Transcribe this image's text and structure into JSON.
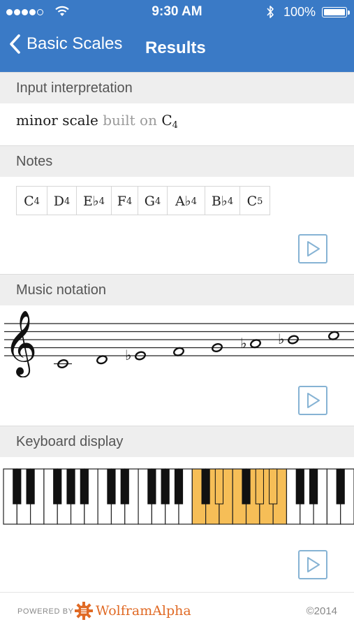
{
  "status_bar": {
    "time": "9:30 AM",
    "battery": "100%",
    "signal_bars_filled": 4,
    "signal_bars_total": 5
  },
  "nav": {
    "back_label": "Basic Scales",
    "title": "Results"
  },
  "pods": {
    "input": {
      "title": "Input interpretation",
      "text_main": "minor scale",
      "text_connector": "built on",
      "note_letter": "C",
      "note_octave": "4"
    },
    "notes": {
      "title": "Notes",
      "items": [
        {
          "name": "C",
          "octave": "4"
        },
        {
          "name": "D",
          "octave": "4"
        },
        {
          "name": "E♭",
          "octave": "4"
        },
        {
          "name": "F",
          "octave": "4"
        },
        {
          "name": "G",
          "octave": "4"
        },
        {
          "name": "A♭",
          "octave": "4"
        },
        {
          "name": "B♭",
          "octave": "4"
        },
        {
          "name": "C",
          "octave": "5"
        }
      ]
    },
    "notation": {
      "title": "Music notation",
      "clef": "treble-clef-icon",
      "notes": [
        {
          "pitch": "C4",
          "accidental": ""
        },
        {
          "pitch": "D4",
          "accidental": ""
        },
        {
          "pitch": "E4",
          "accidental": "flat"
        },
        {
          "pitch": "F4",
          "accidental": ""
        },
        {
          "pitch": "G4",
          "accidental": ""
        },
        {
          "pitch": "A4",
          "accidental": "flat"
        },
        {
          "pitch": "B4",
          "accidental": "flat"
        },
        {
          "pitch": "C5",
          "accidental": ""
        }
      ]
    },
    "keyboard": {
      "title": "Keyboard display",
      "white_key_count": 26,
      "highlighted_white_keys": [
        14,
        15,
        16,
        17,
        18,
        19,
        20
      ],
      "highlighted_black_keys": [
        15,
        18,
        19
      ],
      "highlight_color": "#f6be57"
    }
  },
  "play_button_icon": "play-icon",
  "footer": {
    "powered_by": "POWERED BY",
    "brand": "WolframAlpha",
    "brand_icon": "wolfram-star-icon",
    "copyright": "©2014"
  },
  "colors": {
    "header_bg": "#3a7ac6",
    "pod_header_bg": "#eeeeee",
    "play_button": "#86b3d4",
    "brand": "#e06a25"
  }
}
